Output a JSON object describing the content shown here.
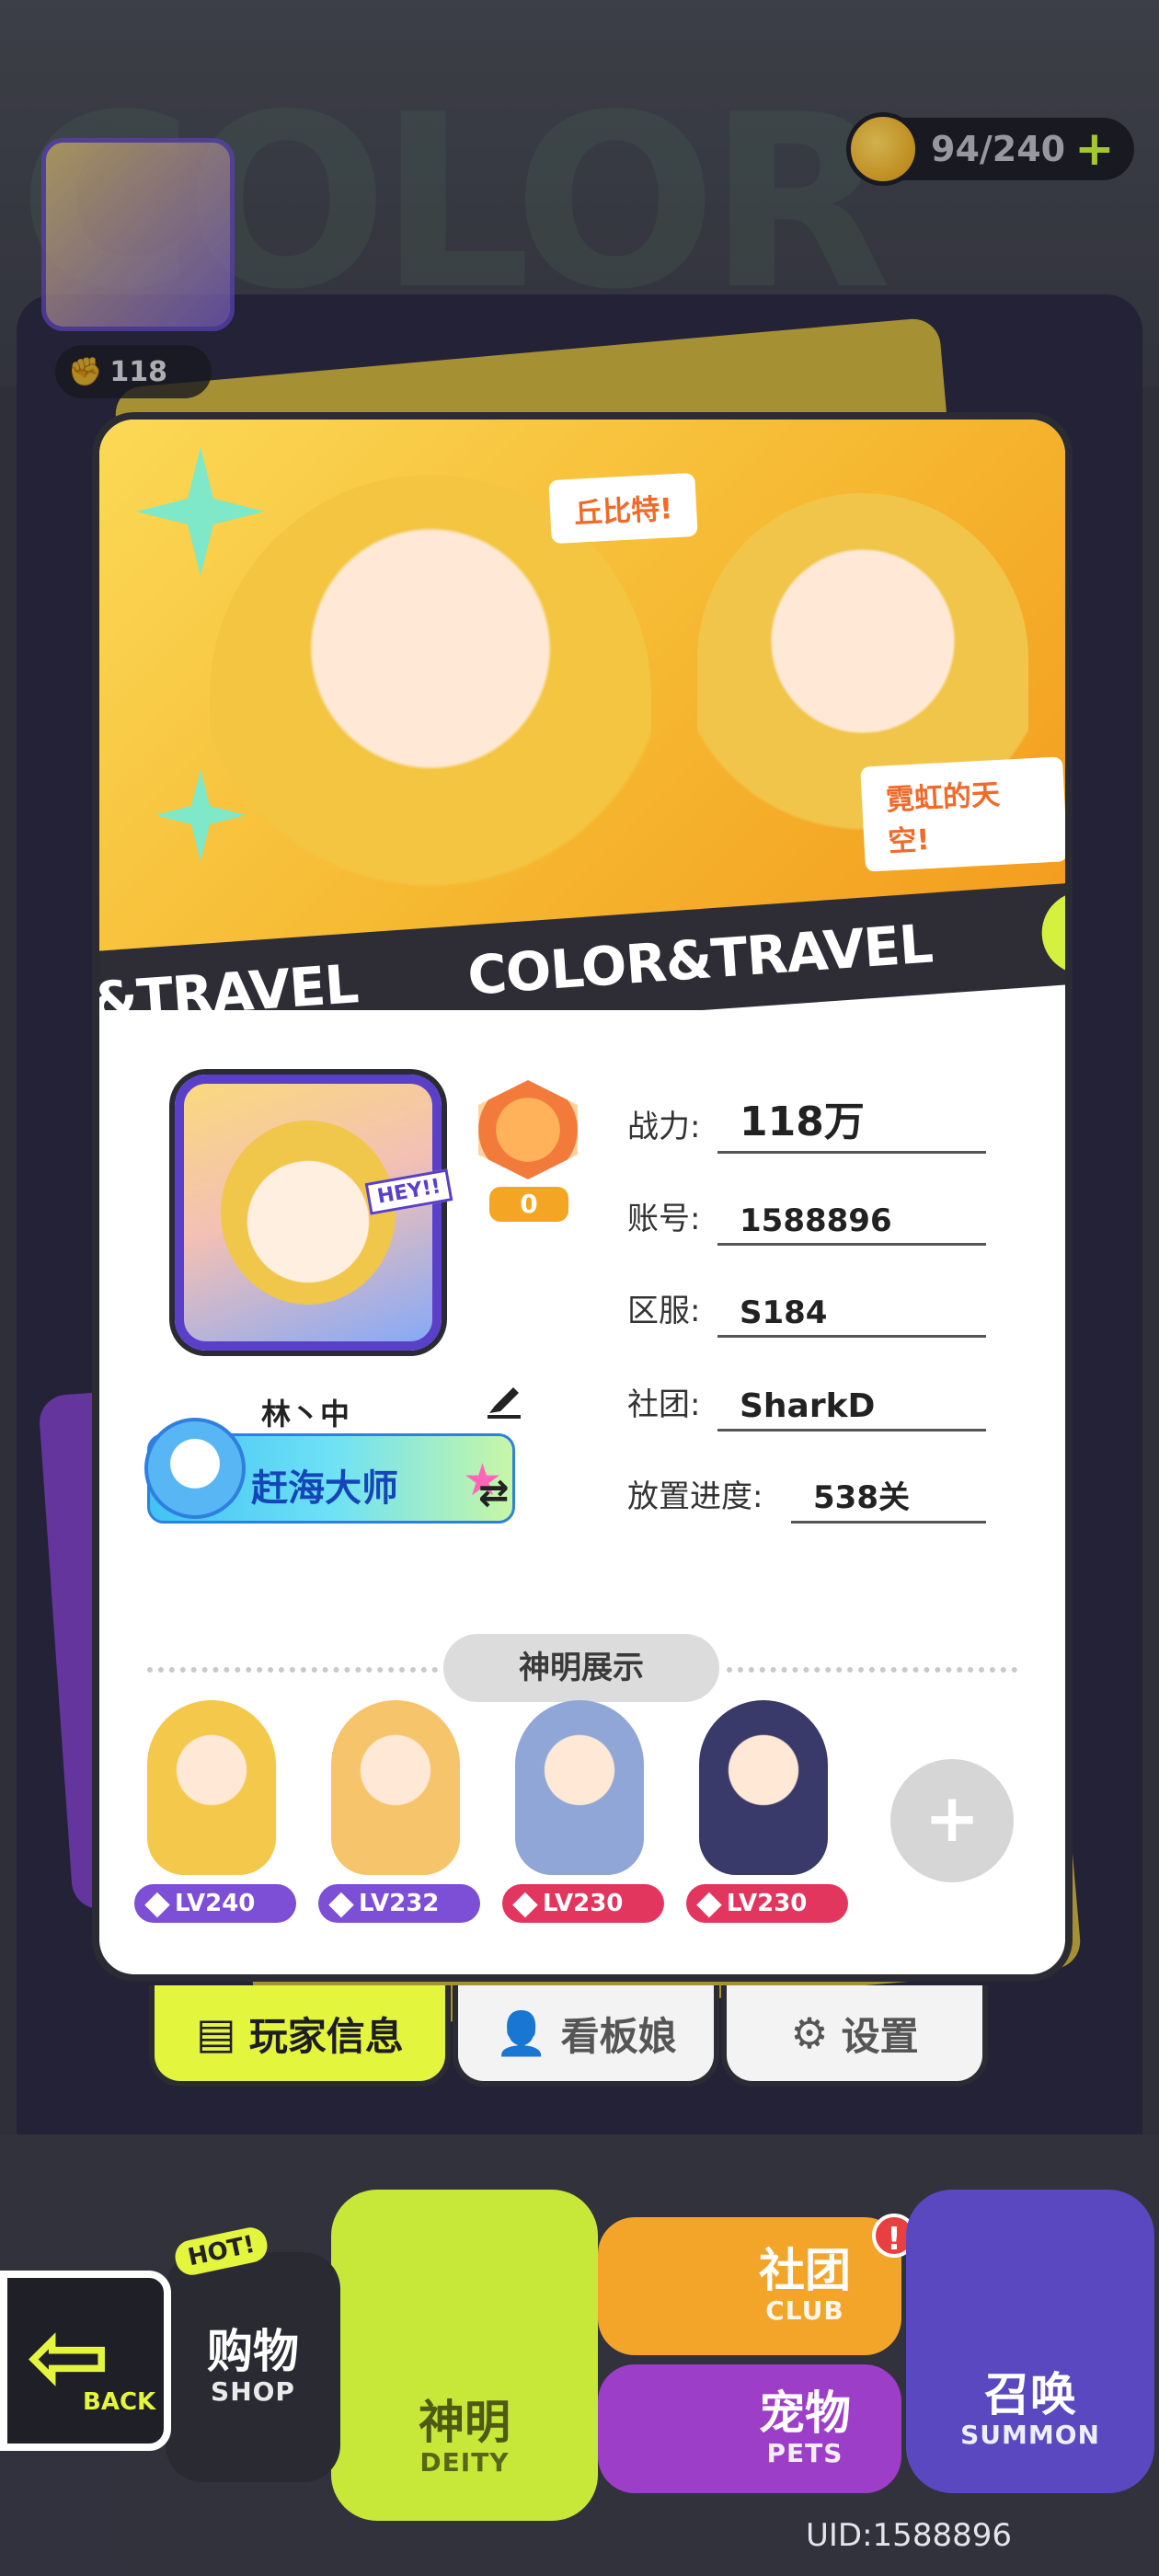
{
  "hud": {
    "power_short": "118",
    "stamina": "94/240",
    "stamina_plus": "+"
  },
  "card": {
    "bubble_1": "丘比特!",
    "bubble_2": "霓虹的天空!",
    "ribbon_left": "&TRAVEL",
    "ribbon_main": "COLOR&TRAVEL",
    "ribbon_logo": "⊜"
  },
  "profile": {
    "rank_level": "0",
    "nickname": "林丶中",
    "title_badge": "赶海大师",
    "avatar_tag": "HEY!!",
    "fields": [
      {
        "label": "战力:",
        "value": "118万"
      },
      {
        "label": "账号:",
        "value": "1588896"
      },
      {
        "label": "区服:",
        "value": "S184"
      },
      {
        "label": "社团:",
        "value": "SharkD"
      },
      {
        "label": "放置进度:",
        "value": "538关"
      }
    ]
  },
  "deity": {
    "header": "神明展示",
    "items": [
      {
        "level": "LV240"
      },
      {
        "level": "LV232"
      },
      {
        "level": "LV230"
      },
      {
        "level": "LV230"
      }
    ],
    "add_label": "+"
  },
  "tabs": {
    "player": "玩家信息",
    "mascot": "看板娘",
    "settings": "设置"
  },
  "nav": {
    "back": "BACK",
    "hot": "HOT!",
    "shop_cn": "购物",
    "shop_en": "SHOP",
    "deity_cn": "神明",
    "deity_en": "DEITY",
    "club_cn": "社团",
    "club_en": "CLUB",
    "pets_cn": "宠物",
    "pets_en": "PETS",
    "summon_cn": "召唤",
    "summon_en": "SUMMON",
    "club_alert": "!"
  },
  "uid": "UID:1588896",
  "colors": {
    "accent_lime": "#e4f53e",
    "card_border": "#2b2b33",
    "banner_yellow": "#fbd956"
  }
}
